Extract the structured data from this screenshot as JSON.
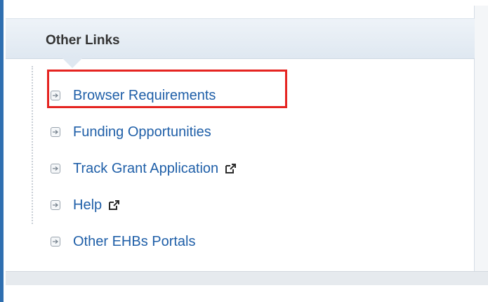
{
  "panel": {
    "title": "Other Links"
  },
  "links": [
    {
      "label": "Browser Requirements",
      "icon": "arrow-right-box-icon",
      "external": false,
      "highlighted": true
    },
    {
      "label": "Funding Opportunities",
      "icon": "arrow-right-box-icon",
      "external": false,
      "highlighted": false
    },
    {
      "label": "Track Grant Application",
      "icon": "arrow-right-box-icon",
      "external": true,
      "external_icon": "external-link-icon",
      "highlighted": false
    },
    {
      "label": "Help",
      "icon": "arrow-right-box-icon",
      "external": true,
      "external_icon": "external-link-icon",
      "highlighted": false
    },
    {
      "label": "Other EHBs Portals",
      "icon": "arrow-right-box-icon",
      "external": false,
      "highlighted": false
    }
  ],
  "colors": {
    "link": "#1f5fa8",
    "highlight_border": "#e52421",
    "accent": "#2f6fb0"
  }
}
